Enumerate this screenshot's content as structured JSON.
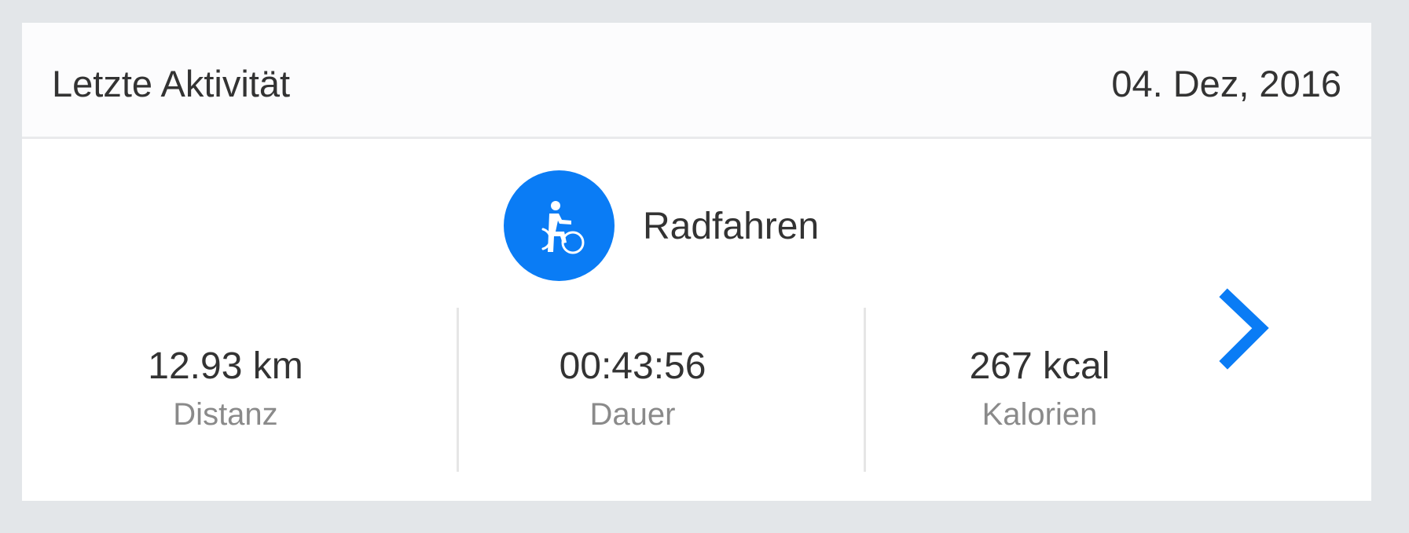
{
  "header": {
    "title": "Letzte Aktivität",
    "date": "04. Dez, 2016"
  },
  "activity": {
    "name": "Radfahren",
    "icon": "cycling-icon",
    "icon_bg_color": "#0a7cf5"
  },
  "stats": [
    {
      "value": "12.93 km",
      "label": "Distanz"
    },
    {
      "value": "00:43:56",
      "label": "Dauer"
    },
    {
      "value": "267 kcal",
      "label": "Kalorien"
    }
  ],
  "accent_color": "#0a7cf5",
  "next_icon": "chevron-right-icon"
}
